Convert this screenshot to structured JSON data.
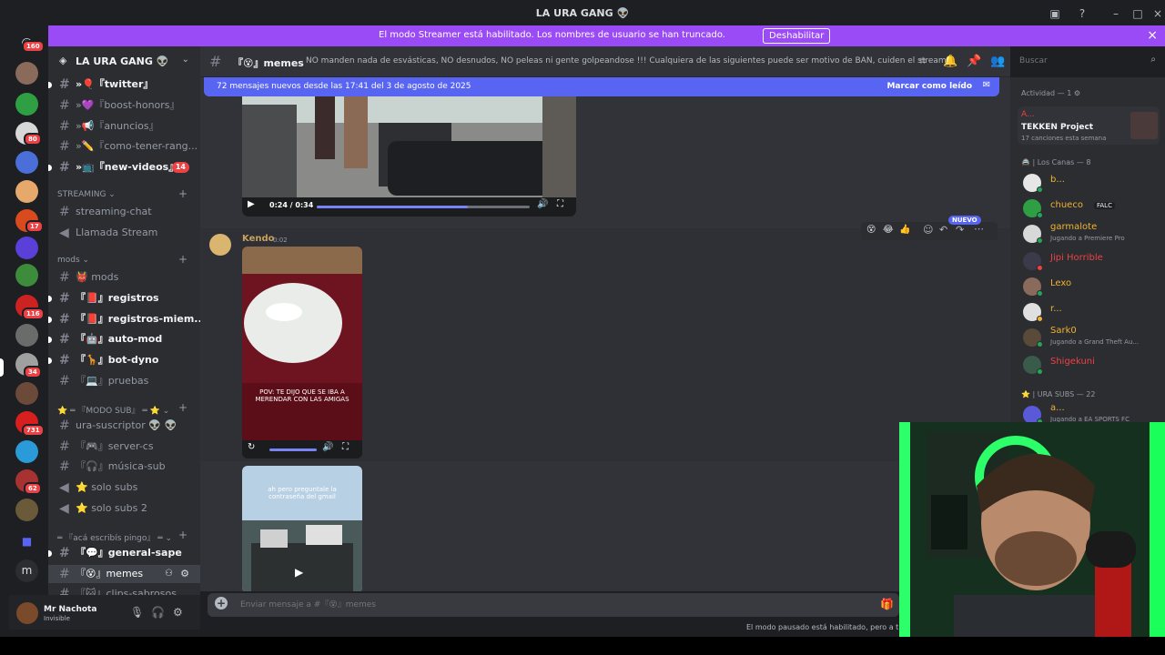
{
  "window": {
    "title": "LA URA GANG 👽"
  },
  "banner": {
    "text": "El modo Streamer está habilitado. Los nombres de usuario se han truncado.",
    "button": "Deshabilitar"
  },
  "rail": {
    "badges": [
      "160",
      "80",
      "17",
      "116",
      "34",
      "731",
      "62"
    ],
    "letter": "m"
  },
  "server": {
    "name": "LA URA GANG 👽"
  },
  "sidebar": {
    "top_channels": [
      {
        "label": "»🎈『twitter』"
      },
      {
        "label": "»💜『boost-honors』"
      },
      {
        "label": "»📢『anuncios』"
      },
      {
        "label": "»✏️『como-tener-rang..."
      },
      {
        "label": "»📺『new-videos』",
        "badge": "14"
      }
    ],
    "streaming_category": "STREAMING",
    "streaming_channels": [
      {
        "label": "streaming-chat"
      },
      {
        "label": "Llamada Stream"
      }
    ],
    "mods_category": "mods",
    "mods_channels": [
      {
        "label": "👹 mods"
      },
      {
        "label": "『📕』registros"
      },
      {
        "label": "『📕』registros-miem..."
      },
      {
        "label": "『🤖』auto-mod"
      },
      {
        "label": "『🦒』bot-dyno"
      },
      {
        "label": "『💻』pruebas"
      }
    ],
    "sub_category": "⭐ ═ 『MODO SUB』 ═ ⭐",
    "sub_channels": [
      {
        "label": "ura-suscriptor 👽 👽"
      },
      {
        "label": "『🎮』server-cs"
      },
      {
        "label": "『🎧』música-sub"
      },
      {
        "label": "⭐ solo subs"
      },
      {
        "label": "⭐ solo subs 2"
      }
    ],
    "pingo_category": "═ 『acá escribís pingo』 ═",
    "pingo_channels": [
      {
        "label": "『💬』general-sape"
      },
      {
        "label": "『😵』memes"
      },
      {
        "label": "『🐱』clips-sabrosos"
      }
    ]
  },
  "user": {
    "name": "Mr Nachota",
    "status": "Invisible"
  },
  "channel": {
    "name": "『😵』memes",
    "topic": "NO manden nada de esvásticas, NO desnudos, NO peleas ni gente golpeandose !!! Cualquiera de las siguientes puede ser motivo de BAN, cuiden el stream!"
  },
  "search": {
    "placeholder": "Buscar"
  },
  "new_messages": {
    "text": "72 mensajes nuevos desde las 17:41 del 3 de agosto de 2025",
    "mark_read": "Marcar como leído"
  },
  "video1": {
    "time": "0:24 / 0:34",
    "progress": 0.71
  },
  "message": {
    "author": "Kendo",
    "time": "0:02",
    "new_label": "NUEVO",
    "video_caption": "POV: TE DIJO QUE SE IBA A MERENDAR CON LAS AMIGAS",
    "video2_caption": "ah pero preguntale la contraseña del gmail"
  },
  "composer": {
    "placeholder": "Enviar mensaje a #『😵』memes"
  },
  "slowmode": "El modo pausado está habilitado, pero a ti",
  "members": {
    "activity_header": "Actividad — 1",
    "activity_user": "A...",
    "activity_title": "TEKKEN Project",
    "activity_sub": "17 canciones esta semana",
    "canas_header": "🚔 | Los Canas — 8",
    "canas": [
      {
        "name": "b...",
        "color": "#f0b232",
        "status": "#23a55a",
        "sub": ""
      },
      {
        "name": "chueco",
        "color": "#f0b232",
        "status": "#23a55a",
        "sub": "",
        "tag": "FALC"
      },
      {
        "name": "garmalote",
        "color": "#f0b232",
        "status": "#23a55a",
        "sub": "Jugando a Premiere Pro"
      },
      {
        "name": "Jipi Horrible",
        "color": "#ed4245",
        "status": "#f23f43",
        "sub": ""
      },
      {
        "name": "Lexo",
        "color": "#f0b232",
        "status": "#23a55a",
        "sub": ""
      },
      {
        "name": "r...",
        "color": "#f0b232",
        "status": "#f0b232",
        "sub": ""
      },
      {
        "name": "Sark0",
        "color": "#f0b232",
        "status": "#23a55a",
        "sub": "Jugando a Grand Theft Au..."
      },
      {
        "name": "Shigekuni",
        "color": "#ed4245",
        "status": "#23a55a",
        "sub": ""
      }
    ],
    "subs_header": "⭐ | URA SUBS — 22",
    "subs_first": {
      "name": "a...",
      "sub": "Jugando a EA SPORTS FC"
    }
  }
}
